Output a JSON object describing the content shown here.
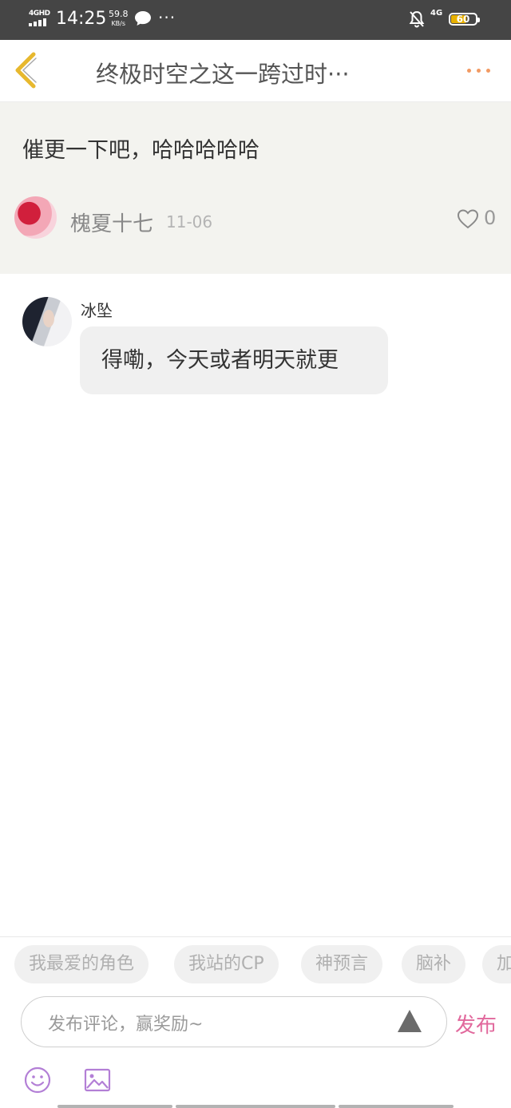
{
  "status_bar": {
    "network": "4GHD",
    "time": "14:25",
    "speed_value": "59.8",
    "speed_unit": "KB/s",
    "more": "···",
    "network_right": "4G",
    "battery_percent": "60"
  },
  "header": {
    "title": "终极时空之这一跨过时···"
  },
  "post": {
    "text": "催更一下吧，哈哈哈哈哈",
    "author": "槐夏十七",
    "date": "11-06",
    "like_count": "0"
  },
  "reply": {
    "author": "冰坠",
    "text": "得嘞，今天或者明天就更"
  },
  "bottom": {
    "tags": [
      "我最爱的角色",
      "我站的CP",
      "神预言",
      "脑补",
      "加"
    ],
    "comment_placeholder": "发布评论，赢奖励~",
    "publish_label": "发布"
  },
  "colors": {
    "accent_more": "#f29a63",
    "back_arrow": "#e7b82e",
    "publish": "#e1689c",
    "toolbar_icons": "#b37fd6",
    "post_background": "#f3f3ef"
  },
  "icons": {
    "back": "back-chevron-icon",
    "more": "more-dots-icon",
    "like": "heart-icon",
    "send": "triangle-icon",
    "emoji": "smiley-icon",
    "image": "image-icon"
  }
}
